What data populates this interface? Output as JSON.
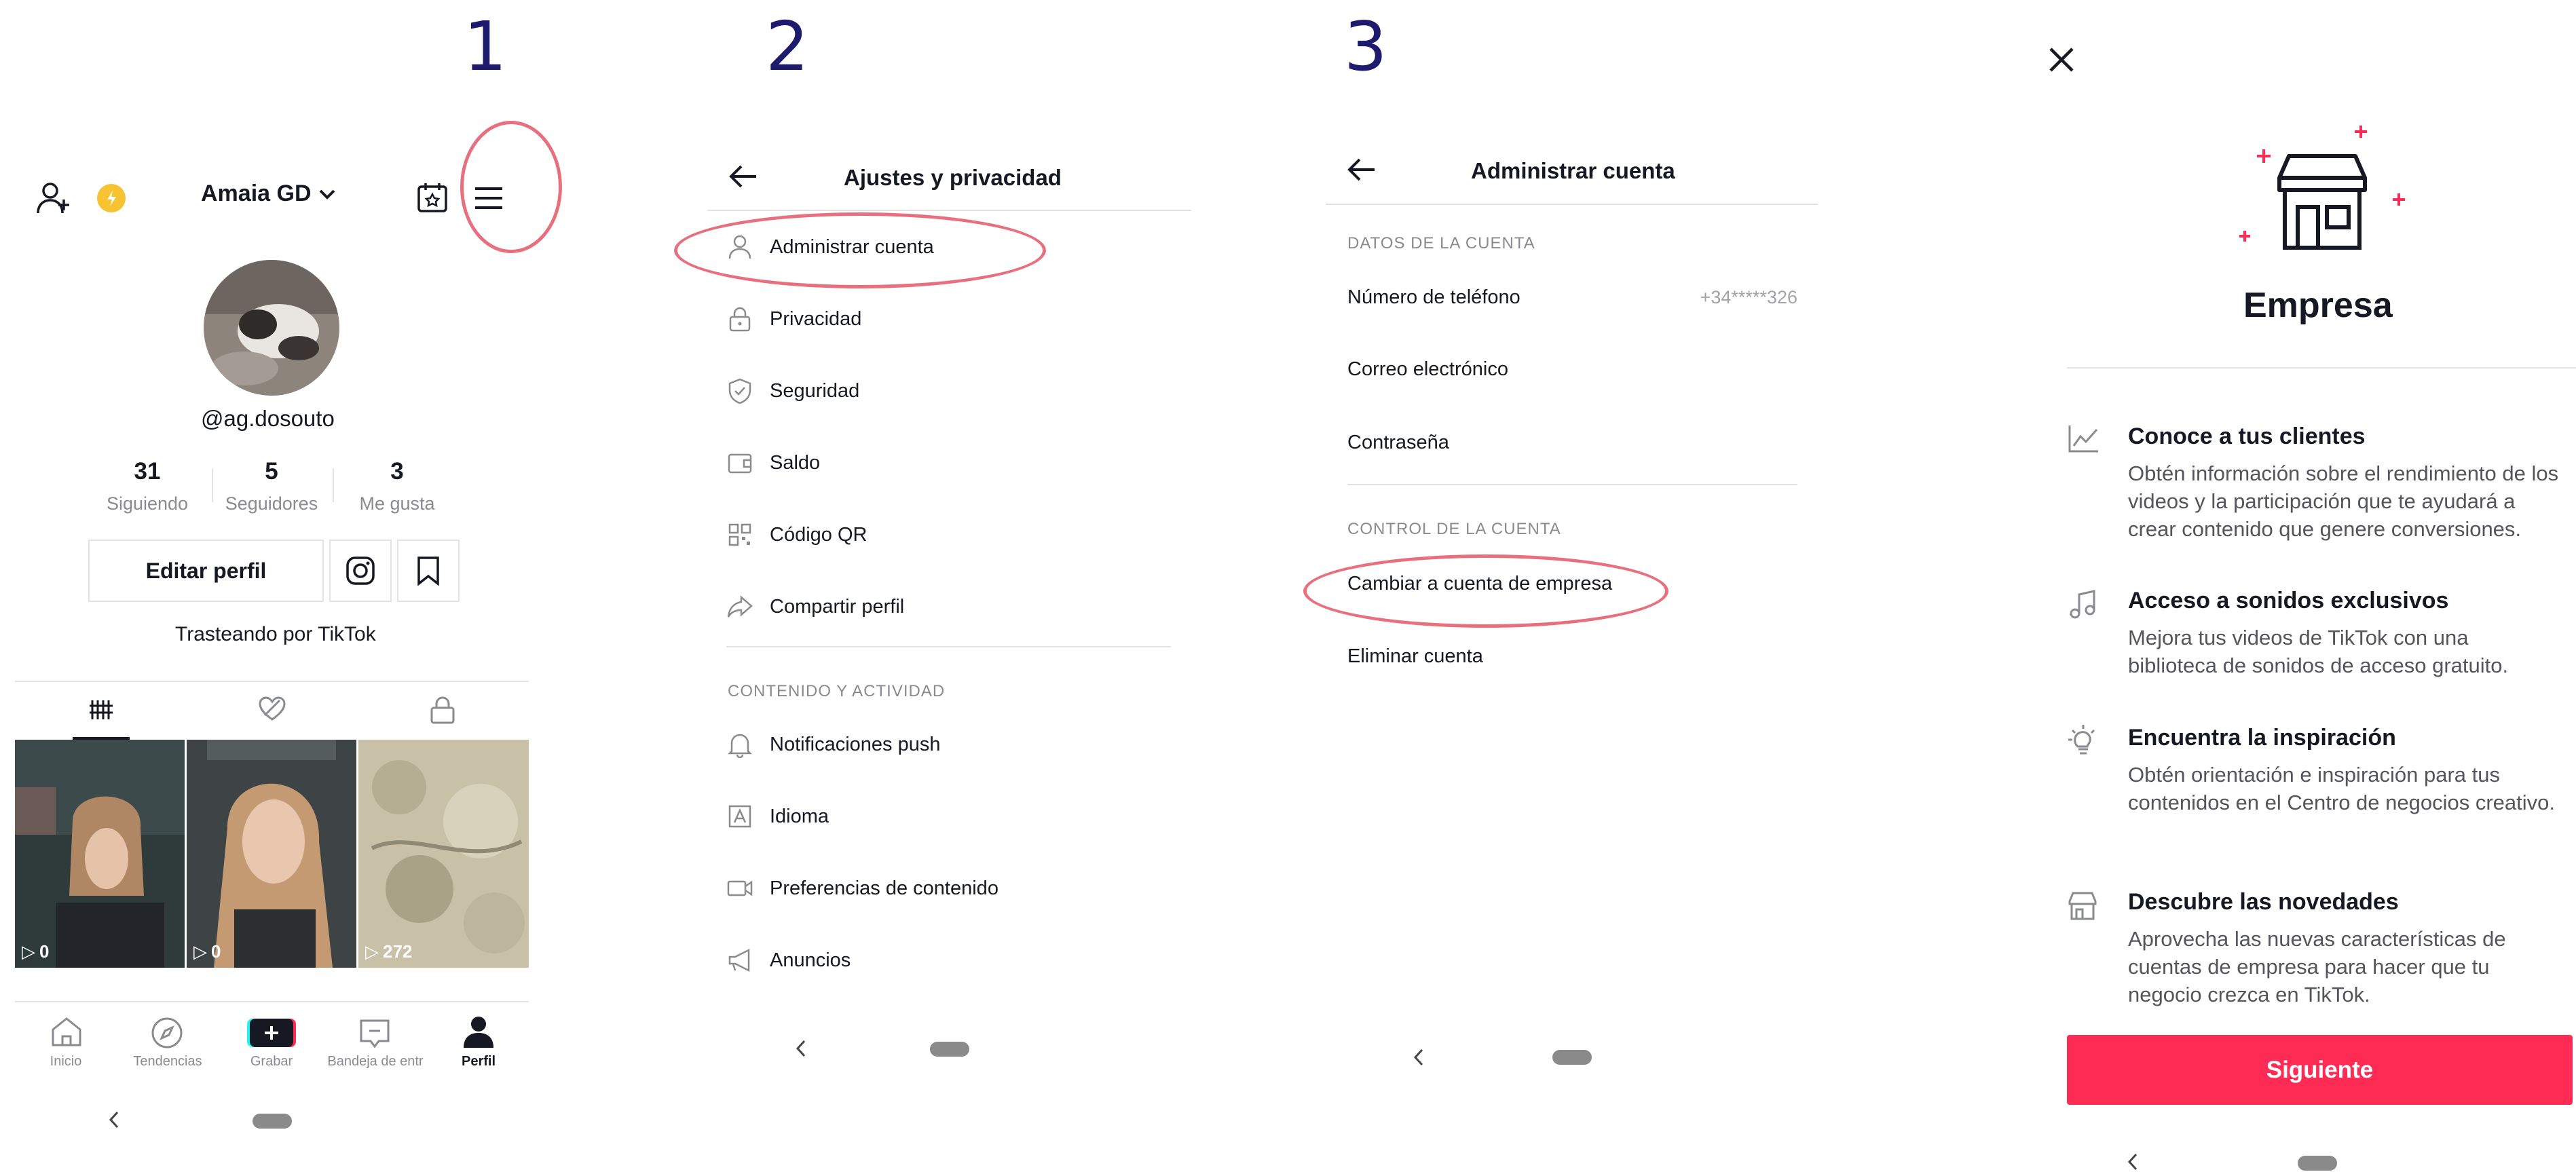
{
  "step_numbers": [
    "1",
    "2",
    "3"
  ],
  "profile": {
    "username": "Amaia GD",
    "handle": "@ag.dosouto",
    "stats": [
      {
        "value": "31",
        "label": "Siguiendo"
      },
      {
        "value": "5",
        "label": "Seguidores"
      },
      {
        "value": "3",
        "label": "Me gusta"
      }
    ],
    "edit_button": "Editar perfil",
    "bio": "Trasteando por TikTok",
    "videos": [
      {
        "views": "0"
      },
      {
        "views": "0"
      },
      {
        "views": "272"
      }
    ],
    "nav": [
      "Inicio",
      "Tendencias",
      "Grabar",
      "Bandeja de entr",
      "Perfil"
    ]
  },
  "settings": {
    "title": "Ajustes y privacidad",
    "account_items": [
      {
        "label": "Administrar cuenta",
        "icon": "person-icon"
      },
      {
        "label": "Privacidad",
        "icon": "lock-icon"
      },
      {
        "label": "Seguridad",
        "icon": "shield-icon"
      },
      {
        "label": "Saldo",
        "icon": "wallet-icon"
      },
      {
        "label": "Código QR",
        "icon": "qr-code-icon"
      },
      {
        "label": "Compartir perfil",
        "icon": "share-icon"
      }
    ],
    "section_content": "CONTENIDO Y ACTIVIDAD",
    "content_items": [
      {
        "label": "Notificaciones push",
        "icon": "bell-icon"
      },
      {
        "label": "Idioma",
        "icon": "language-icon"
      },
      {
        "label": "Preferencias de contenido",
        "icon": "video-icon"
      },
      {
        "label": "Anuncios",
        "icon": "megaphone-icon"
      }
    ]
  },
  "manage_account": {
    "title": "Administrar cuenta",
    "section_data": "DATOS DE LA CUENTA",
    "phone_label": "Número de teléfono",
    "phone_value": "+34*****326",
    "email_label": "Correo electrónico",
    "password_label": "Contraseña",
    "section_control": "CONTROL DE LA CUENTA",
    "switch_business": "Cambiar a cuenta de empresa",
    "delete_account": "Eliminar cuenta"
  },
  "business": {
    "title": "Empresa",
    "features": [
      {
        "title": "Conoce a tus clientes",
        "desc": "Obtén información sobre el rendimiento de los videos y la participación que te ayudará a crear contenido que genere conversiones.",
        "icon": "analytics-icon"
      },
      {
        "title": "Acceso a sonidos exclusivos",
        "desc": "Mejora tus videos de TikTok con una biblioteca de sonidos de acceso gratuito.",
        "icon": "music-note-icon"
      },
      {
        "title": "Encuentra la inspiración",
        "desc": "Obtén orientación e inspiración para tus contenidos en el Centro de negocios creativo.",
        "icon": "lightbulb-icon"
      },
      {
        "title": "Descubre las novedades",
        "desc": "Aprovecha las nuevas características de cuentas de empresa para hacer que tu negocio crezca en TikTok.",
        "icon": "store-icon"
      }
    ],
    "next_button": "Siguiente"
  },
  "colors": {
    "accent": "#fe2c55",
    "highlight": "#e8707e",
    "step_number": "#1e1b6e"
  }
}
